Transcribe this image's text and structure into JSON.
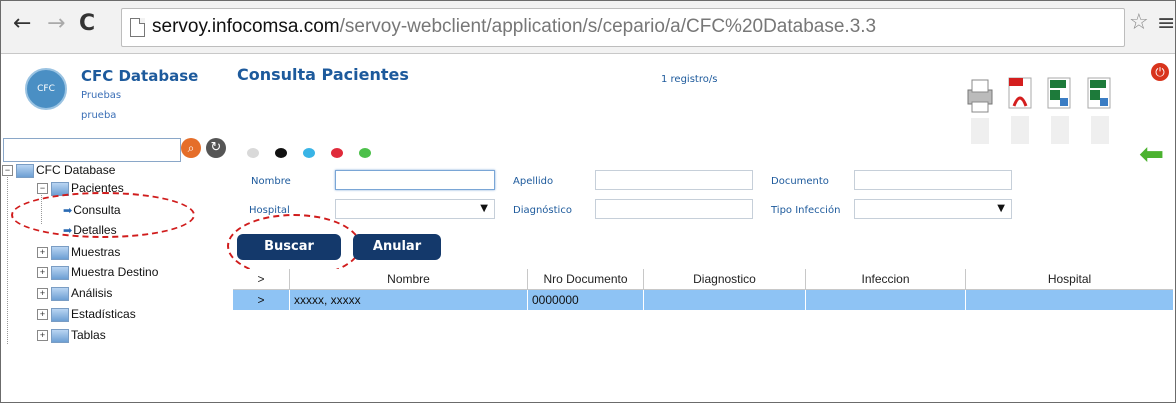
{
  "browser": {
    "back": "←",
    "forward": "→",
    "reload": "C",
    "url_host": "servoy.infocomsa.com",
    "url_path": "/servoy-webclient/application/s/cepario/a/CFC%20Database.3.3",
    "star": "☆",
    "menu": "≡"
  },
  "app": {
    "logo_text": "CFC",
    "title": "CFC Database",
    "subtitle1": "Pruebas",
    "subtitle2": "prueba",
    "search_value": ""
  },
  "tree": {
    "root": "CFC Database",
    "items": [
      {
        "label": "Pacientes"
      },
      {
        "label": "Consulta"
      },
      {
        "label": "Detalles"
      },
      {
        "label": "Muestras"
      },
      {
        "label": "Muestra Destino"
      },
      {
        "label": "Análisis"
      },
      {
        "label": "Estadísticas"
      },
      {
        "label": "Tablas"
      }
    ]
  },
  "main": {
    "title": "Consulta Pacientes",
    "record_count": "1 registro/s",
    "color_dots": [
      "#d9d9d9",
      "#111111",
      "#39b4e6",
      "#e02a3a",
      "#4cc04a"
    ]
  },
  "form": {
    "nombre_label": "Nombre",
    "apellido_label": "Apellido",
    "documento_label": "Documento",
    "hospital_label": "Hospital",
    "diagnostico_label": "Diagnóstico",
    "tipo_infeccion_label": "Tipo Infección",
    "nombre_value": "",
    "apellido_value": "",
    "documento_value": "",
    "hospital_value": "",
    "diagnostico_value": "",
    "tipo_infeccion_value": "",
    "buscar_label": "Buscar",
    "anular_label": "Anular"
  },
  "grid": {
    "columns": [
      ">",
      "Nombre",
      "Nro Documento",
      "Diagnostico",
      "Infeccion",
      "Hospital"
    ],
    "rows": [
      {
        "selector": ">",
        "nombre": "xxxxx, xxxxx",
        "documento": "0000000",
        "diagnostico": "",
        "infeccion": "",
        "hospital": ""
      }
    ]
  },
  "colors": {
    "accent": "#1d5a9c",
    "button": "#14396b",
    "selected_row": "#8ec3f4",
    "annotation": "#d01c1c"
  }
}
